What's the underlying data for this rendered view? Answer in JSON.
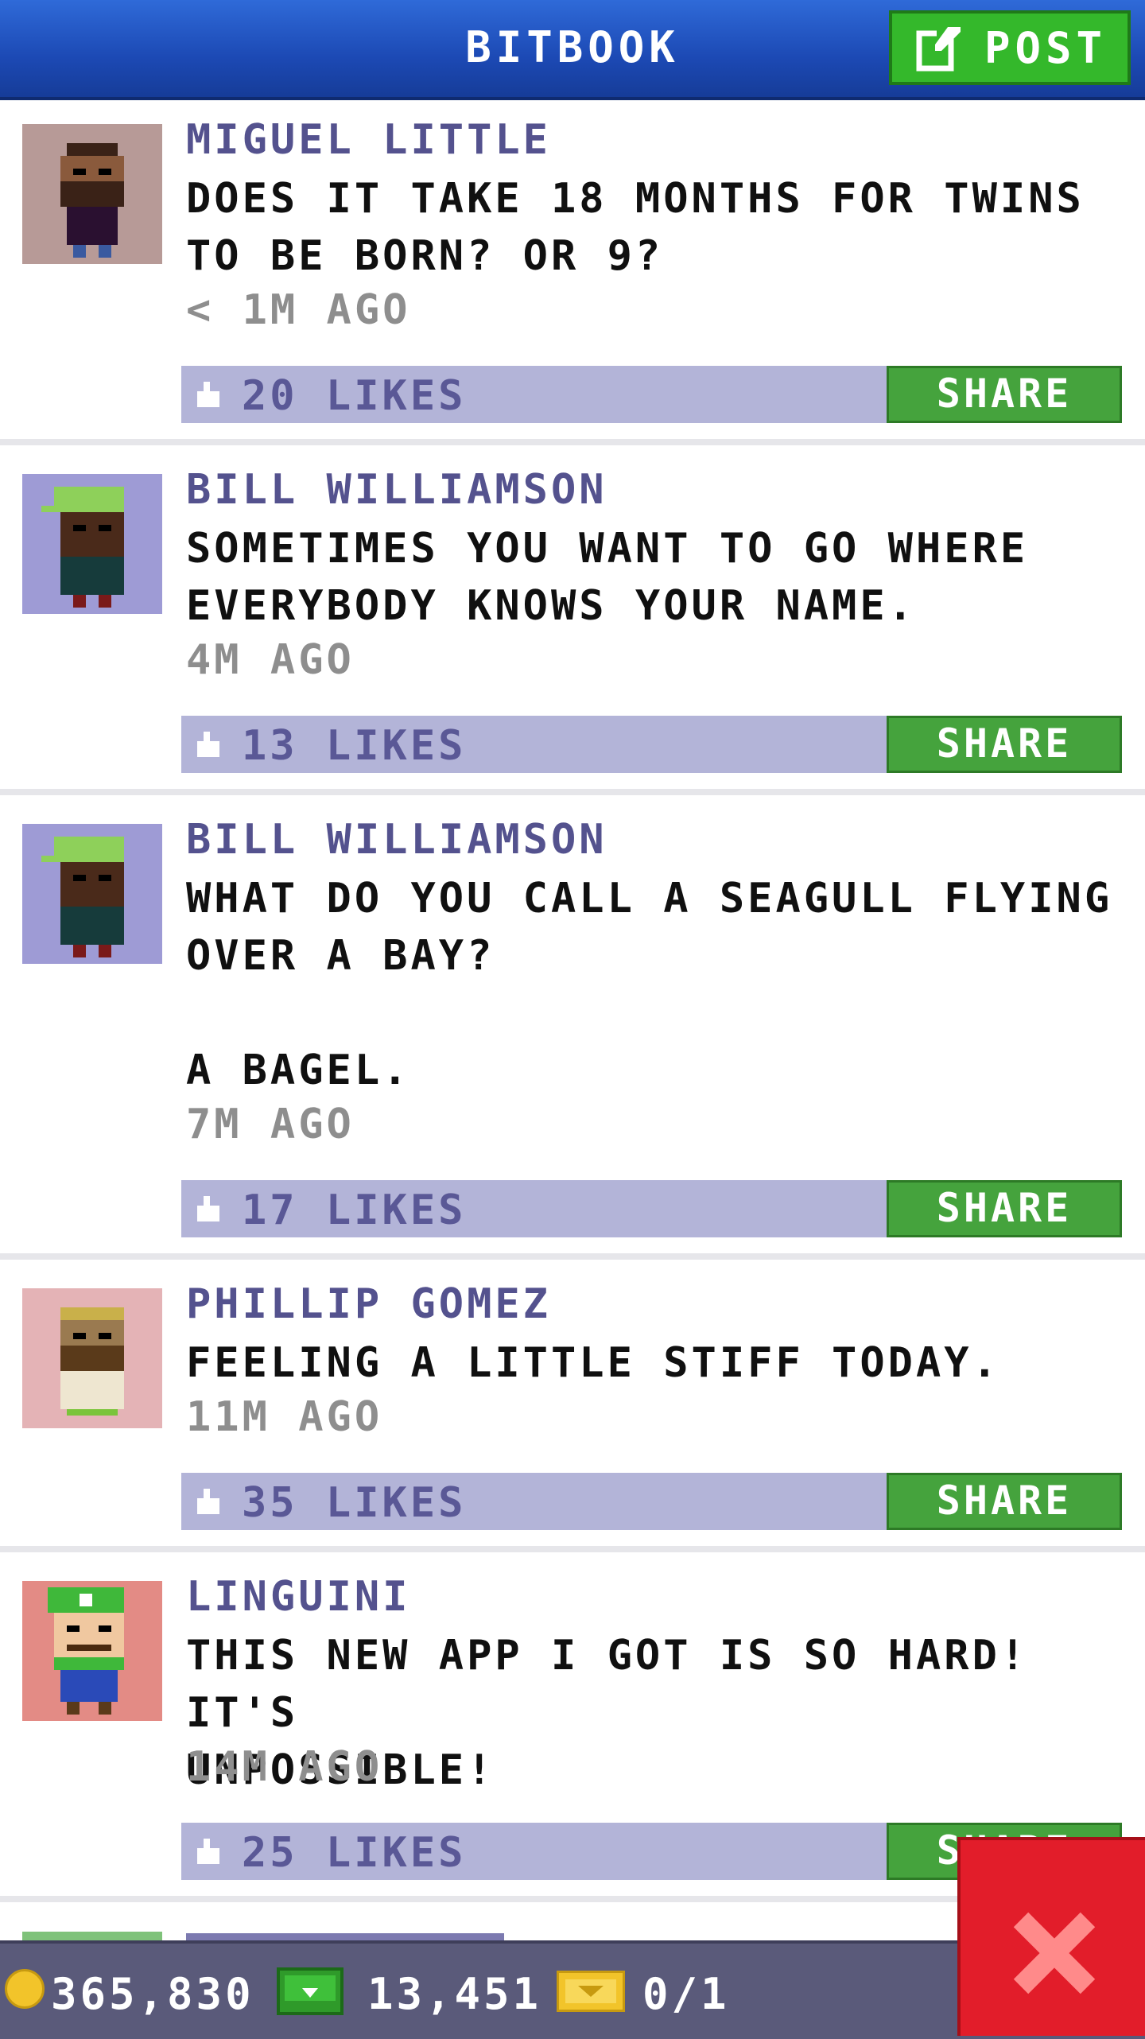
{
  "header": {
    "title": "BITBOOK",
    "post_label": "POST"
  },
  "posts": [
    {
      "author": "MIGUEL LITTLE",
      "text": "DOES IT TAKE 18 MONTHS FOR TWINS\nTO BE BORN? OR 9?",
      "time": "< 1M AGO",
      "likes": "20 LIKES",
      "share": "SHARE",
      "avatar_bg": "#b79a97"
    },
    {
      "author": "BILL WILLIAMSON",
      "text": "SOMETIMES YOU WANT TO GO WHERE\nEVERYBODY KNOWS YOUR NAME.",
      "time": "4M AGO",
      "likes": "13 LIKES",
      "share": "SHARE",
      "avatar_bg": "#9e9bd5"
    },
    {
      "author": "BILL WILLIAMSON",
      "text": "WHAT DO YOU CALL A SEAGULL FLYING\nOVER A BAY?\n\nA BAGEL.",
      "time": "7M AGO",
      "likes": "17 LIKES",
      "share": "SHARE",
      "avatar_bg": "#9e9bd5"
    },
    {
      "author": "PHILLIP GOMEZ",
      "text": "FEELING A LITTLE STIFF TODAY.",
      "time": "11M AGO",
      "likes": "35 LIKES",
      "share": "SHARE",
      "avatar_bg": "#e4b3b6"
    },
    {
      "author": "LINGUINI",
      "text": "THIS NEW APP I GOT IS SO HARD! IT'S\nUNPOSSIBLE!",
      "time": "14M AGO",
      "likes": "25 LIKES",
      "share": "SHARE",
      "avatar_bg": "#e38b85"
    }
  ],
  "status": {
    "coins": "365,830",
    "bux": "13,451",
    "tickets": "0/1"
  },
  "colors": {
    "header_blue": "#1c49b4",
    "post_green": "#34b82b",
    "author_purple": "#54528e",
    "like_bar": "#b3b4d8",
    "share_green": "#45a33d",
    "close_red": "#e21d2a"
  }
}
